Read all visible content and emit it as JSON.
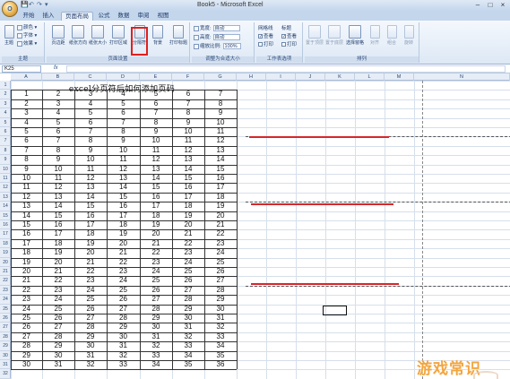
{
  "window": {
    "title": "Book5 - Microsoft Excel",
    "orb_label": "O",
    "controls": [
      "–",
      "□",
      "×"
    ]
  },
  "qat": [
    "💾",
    "↶",
    "↷",
    "▾"
  ],
  "tabs": [
    "开始",
    "插入",
    "页面布局",
    "公式",
    "数据",
    "审阅",
    "视图"
  ],
  "active_tab": "页面布局",
  "ribbon": {
    "theme": {
      "big": "主题",
      "items": [
        "颜色 ▾",
        "字体 ▾",
        "效果 ▾"
      ],
      "label": "主题"
    },
    "page_setup": {
      "buttons": [
        "页边距",
        "纸张方向",
        "纸张大小",
        "打印区域",
        "分隔符",
        "背景",
        "打印标题"
      ],
      "label": "页面设置"
    },
    "scale": {
      "rows": [
        {
          "name": "宽度:",
          "value": "自动"
        },
        {
          "name": "高度:",
          "value": "自动"
        },
        {
          "name": "缩放比例:",
          "value": "100%"
        }
      ],
      "label": "调整为合适大小"
    },
    "sheet_options": {
      "cols": [
        "网格线",
        "标题"
      ],
      "rows": [
        "查看",
        "打印"
      ],
      "label": "工作表选项"
    },
    "arrange": {
      "buttons": [
        "置于顶层",
        "置于底层",
        "选择窗格",
        "对齐",
        "组合",
        "旋转"
      ],
      "label": "排列"
    }
  },
  "formula_bar": {
    "name_box": "K25",
    "fx": "fx",
    "value": ""
  },
  "columns": [
    "A",
    "B",
    "C",
    "D",
    "E",
    "F",
    "G",
    "H",
    "I",
    "J",
    "K",
    "L",
    "M",
    "N"
  ],
  "row_numbers": [
    "1",
    "2",
    "3",
    "4",
    "5",
    "6",
    "7",
    "8",
    "9",
    "10",
    "11",
    "12",
    "13",
    "14",
    "15",
    "16",
    "17",
    "18",
    "19",
    "20",
    "21",
    "22",
    "23",
    "24",
    "25",
    "26",
    "27",
    "28",
    "29",
    "30",
    "31",
    "32"
  ],
  "sheet": {
    "title": "excel分页符后如何添加页码",
    "rows": [
      [
        1,
        2,
        3,
        4,
        5,
        6,
        7
      ],
      [
        2,
        3,
        4,
        5,
        6,
        7,
        8
      ],
      [
        3,
        4,
        5,
        6,
        7,
        8,
        9
      ],
      [
        4,
        5,
        6,
        7,
        8,
        9,
        10
      ],
      [
        5,
        6,
        7,
        8,
        9,
        10,
        11
      ],
      [
        6,
        7,
        8,
        9,
        10,
        11,
        12
      ],
      [
        7,
        8,
        9,
        10,
        11,
        12,
        13
      ],
      [
        8,
        9,
        10,
        11,
        12,
        13,
        14
      ],
      [
        9,
        10,
        11,
        12,
        13,
        14,
        15
      ],
      [
        10,
        11,
        12,
        13,
        14,
        15,
        16
      ],
      [
        11,
        12,
        13,
        14,
        15,
        16,
        17
      ],
      [
        12,
        13,
        14,
        15,
        16,
        17,
        18
      ],
      [
        13,
        14,
        15,
        16,
        17,
        18,
        19
      ],
      [
        14,
        15,
        16,
        17,
        18,
        19,
        20
      ],
      [
        15,
        16,
        17,
        18,
        19,
        20,
        21
      ],
      [
        16,
        17,
        18,
        19,
        20,
        21,
        22
      ],
      [
        17,
        18,
        19,
        20,
        21,
        22,
        23
      ],
      [
        18,
        19,
        20,
        21,
        22,
        23,
        24
      ],
      [
        19,
        20,
        21,
        22,
        23,
        24,
        25
      ],
      [
        20,
        21,
        22,
        23,
        24,
        25,
        26
      ],
      [
        21,
        22,
        23,
        24,
        25,
        26,
        27
      ],
      [
        22,
        23,
        24,
        25,
        26,
        27,
        28
      ],
      [
        23,
        24,
        25,
        26,
        27,
        28,
        29
      ],
      [
        24,
        25,
        26,
        27,
        28,
        29,
        30
      ],
      [
        25,
        26,
        27,
        28,
        29,
        30,
        31
      ],
      [
        26,
        27,
        28,
        29,
        30,
        31,
        32
      ],
      [
        27,
        28,
        29,
        30,
        31,
        32,
        33
      ],
      [
        28,
        29,
        30,
        31,
        32,
        33,
        34
      ],
      [
        29,
        30,
        31,
        32,
        33,
        34,
        35
      ],
      [
        30,
        31,
        32,
        33,
        34,
        35,
        36
      ]
    ]
  },
  "watermark": "游戏常识",
  "colors": {
    "highlight": "#e0201e",
    "annotation_line": "#d6272b",
    "watermark": "#f3a53f"
  }
}
